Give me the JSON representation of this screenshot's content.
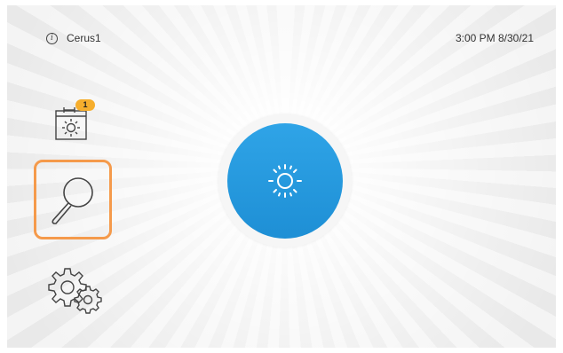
{
  "header": {
    "device_name": "Cerus1",
    "info_icon": "info-icon",
    "datetime": "3:00 PM 8/30/21"
  },
  "sidebar": {
    "schedule": {
      "icon": "calendar-sun-icon",
      "badge_count": "1",
      "badge_color": "#f6ae2d"
    },
    "search": {
      "icon": "magnifier-icon",
      "highlight_color": "#f59a4b"
    },
    "settings": {
      "icon": "gears-icon"
    }
  },
  "main_button": {
    "icon": "sun-icon",
    "color": "#2196dc"
  }
}
